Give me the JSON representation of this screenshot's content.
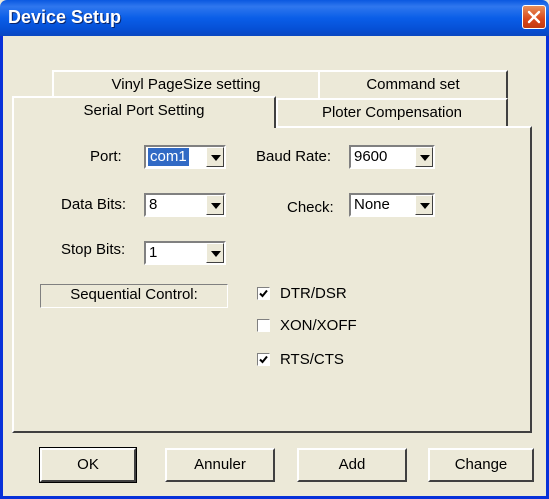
{
  "window": {
    "title": "Device Setup"
  },
  "tabs": {
    "back": [
      "Vinyl PageSize setting",
      "Command set"
    ],
    "front": [
      "Serial Port Setting",
      "Ploter Compensation"
    ]
  },
  "serial": {
    "port": {
      "label": "Port:",
      "value": "com1"
    },
    "baud_rate": {
      "label": "Baud Rate:",
      "value": "9600"
    },
    "data_bits": {
      "label": "Data Bits:",
      "value": "8"
    },
    "check": {
      "label": "Check:",
      "value": "None"
    },
    "stop_bits": {
      "label": "Stop Bits:",
      "value": "1"
    },
    "sequential_control": {
      "label": "Sequential Control:"
    },
    "options": [
      {
        "label": "DTR/DSR",
        "checked": true
      },
      {
        "label": "XON/XOFF",
        "checked": false
      },
      {
        "label": "RTS/CTS",
        "checked": true
      }
    ]
  },
  "buttons": {
    "ok": "OK",
    "cancel": "Annuler",
    "add": "Add",
    "change": "Change"
  },
  "colors": {
    "titlebar": "#0a5ee8",
    "close": "#d8471b",
    "face": "#ece9d8",
    "selection": "#316ac5"
  }
}
